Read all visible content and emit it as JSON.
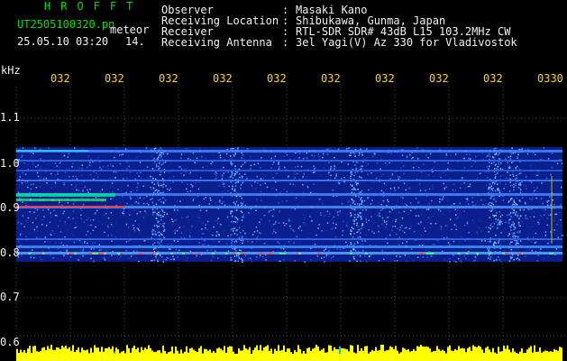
{
  "header": {
    "app_title": "HROFFT",
    "file_name": "UT2505100320.pn",
    "meteor_label": "meteor",
    "datetime": "25.05.10 03:20",
    "count": "14."
  },
  "info_rows": [
    {
      "label": "Observer",
      "colon": ":",
      "value": "Masaki Kano"
    },
    {
      "label": "Receiving Location",
      "colon": ":",
      "value": "Shibukawa, Gunma, Japan"
    },
    {
      "label": "Receiver",
      "colon": ":",
      "value": "RTL-SDR SDR# 43dB L15 103.2MHz CW"
    },
    {
      "label": "Receiving Antenna",
      "colon": ":",
      "value": "3el Yagi(V) Az 330 for Vladivostok"
    }
  ],
  "axis": {
    "y_unit": "kHz",
    "x_ticks": [
      "032",
      "032",
      "032",
      "032",
      "032",
      "032",
      "032",
      "032",
      "032",
      "0330"
    ],
    "y_ticks": [
      "1.1",
      "1.0",
      "0.9",
      "0.8",
      "0.7",
      "0.6"
    ]
  },
  "colors": {
    "text_green": "#00e000",
    "text_white": "#f2f2f2",
    "text_yellow": "#ffd400",
    "background": "#000000",
    "spectrogram_base": "#0a1f8c",
    "bar_yellow": "#ffff00",
    "bar_cyan": "#00c8ff"
  }
}
